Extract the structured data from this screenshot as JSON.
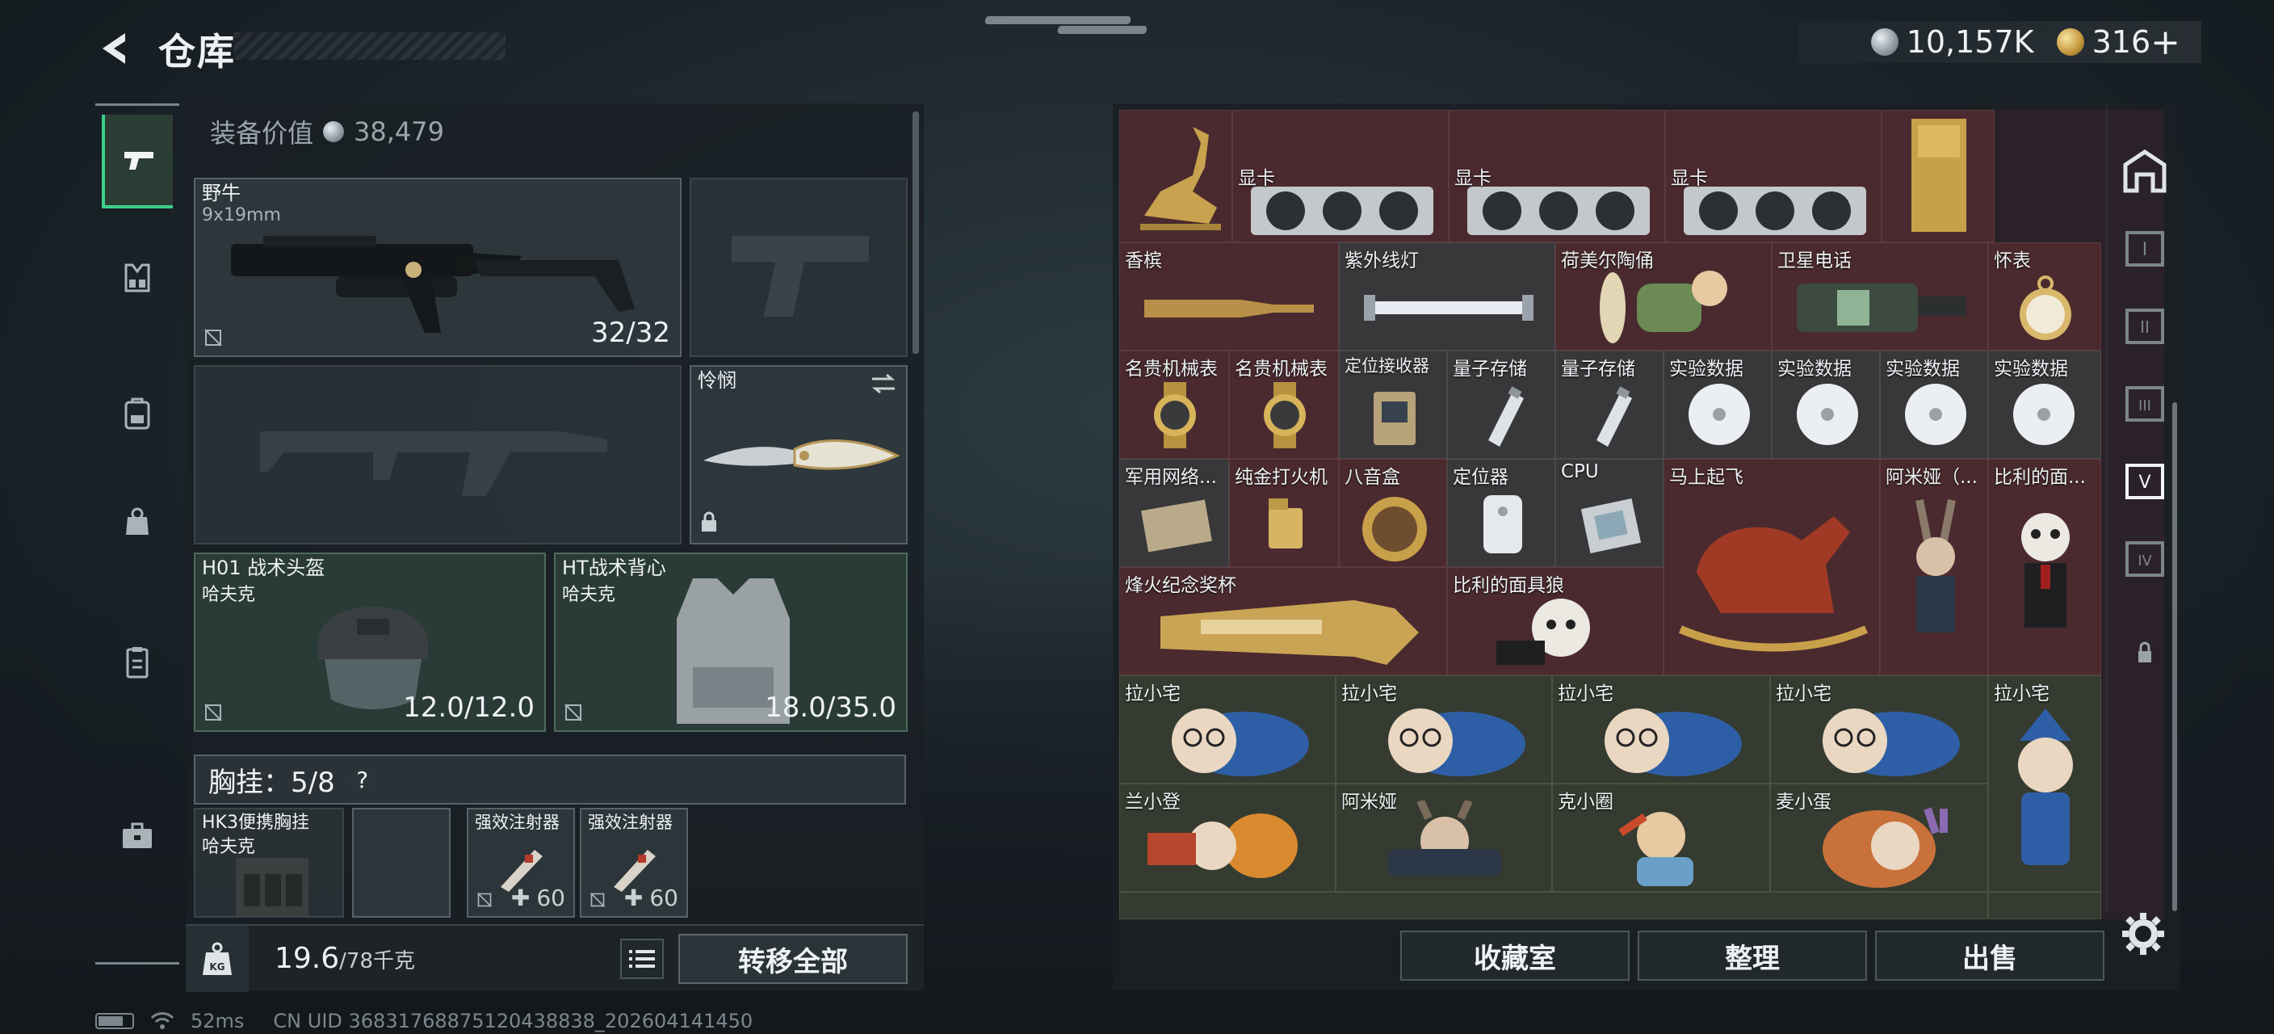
{
  "header": {
    "title": "仓库",
    "currency_silver": "10,157K",
    "currency_gold": "316"
  },
  "equipment": {
    "value_label": "装备价值",
    "value": "38,479",
    "primary_weapon": {
      "name": "野牛",
      "caliber": "9x19mm",
      "ammo": "32/32"
    },
    "melee": {
      "name": "怜悯"
    },
    "helmet": {
      "name": "H01 战术头盔",
      "brand": "哈夫克",
      "durability": "12.0/12.0"
    },
    "vest": {
      "name": "HT战术背心",
      "brand": "哈夫克",
      "durability": "18.0/35.0"
    },
    "chest_rig_label": "胸挂：5/8",
    "chest_rig": {
      "name": "HK3便携胸挂",
      "brand": "哈夫克"
    },
    "injector1": {
      "name": "强效注射器",
      "value": "60"
    },
    "injector2": {
      "name": "强效注射器",
      "value": "60"
    },
    "weight": "19.6",
    "weight_max": "/78千克",
    "transfer_all": "转移全部"
  },
  "stash": {
    "items": [
      {
        "label": ""
      },
      {
        "label": "显卡"
      },
      {
        "label": "显卡"
      },
      {
        "label": "显卡"
      },
      {
        "label": ""
      },
      {
        "label": "香槟"
      },
      {
        "label": "紫外线灯"
      },
      {
        "label": "荷美尔陶俑"
      },
      {
        "label": "卫星电话"
      },
      {
        "label": "怀表"
      },
      {
        "label": "名贵机械表"
      },
      {
        "label": "名贵机械表"
      },
      {
        "label": "定位接收器"
      },
      {
        "label": "量子存储"
      },
      {
        "label": "量子存储"
      },
      {
        "label": "实验数据"
      },
      {
        "label": "实验数据"
      },
      {
        "label": "实验数据"
      },
      {
        "label": "实验数据"
      },
      {
        "label": "军用网络..."
      },
      {
        "label": "纯金打火机"
      },
      {
        "label": "八音盒"
      },
      {
        "label": "定位器"
      },
      {
        "label": "CPU"
      },
      {
        "label": "马上起飞"
      },
      {
        "label": "阿米娅（..."
      },
      {
        "label": "比利的面..."
      },
      {
        "label": "烽火纪念奖杯"
      },
      {
        "label": "比利的面具狼"
      },
      {
        "label": "拉小宅"
      },
      {
        "label": "拉小宅"
      },
      {
        "label": "拉小宅"
      },
      {
        "label": "拉小宅"
      },
      {
        "label": "拉小宅"
      },
      {
        "label": "兰小登"
      },
      {
        "label": "阿米娅"
      },
      {
        "label": "克小圈"
      },
      {
        "label": "麦小蛋"
      }
    ],
    "buttons": {
      "collection": "收藏室",
      "organize": "整理",
      "sell": "出售"
    }
  },
  "status_bar": {
    "ping": "52ms",
    "uid": "CN UID 3683176887512043883​8_202604141450"
  },
  "colors": {
    "accent_green": "#3bd08a",
    "rare_red": "#4a2a2e",
    "gold": "#c3963c"
  }
}
